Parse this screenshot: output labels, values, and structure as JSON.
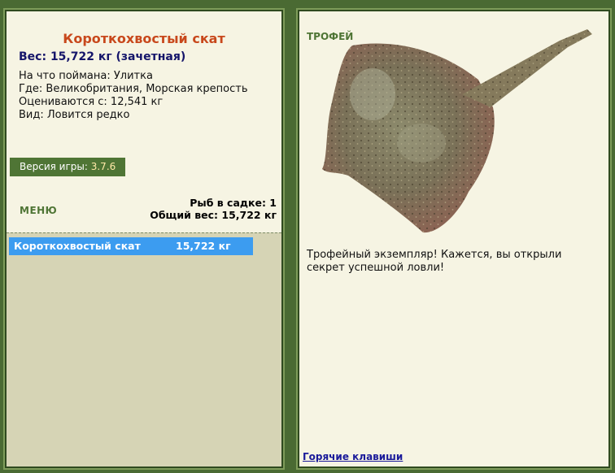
{
  "fish": {
    "name": "Короткохвостый скат",
    "weight_line": "Вес: 15,722 кг (зачетная)",
    "bait": "На что поймана: Улитка",
    "location": "Где: Великобритания, Морская крепость",
    "valued_from": "Оцениваются с: 12,541 кг",
    "rarity": "Вид: Ловится редко"
  },
  "version": {
    "label": "Версия игры:",
    "value": "3.7.6"
  },
  "menu_label": "МЕНЮ",
  "stats": {
    "fish_in_keepnet": "Рыб в садке: 1",
    "total_weight": "Общий вес: 15,722 кг"
  },
  "catch_list": [
    {
      "name": "Короткохвостый скат",
      "weight": "15,722 кг"
    }
  ],
  "trophy": {
    "label": "ТРОФЕЙ",
    "description": "Трофейный экземпляр! Кажется, вы открыли секрет успешной ловли!",
    "image_icon": "stingray-image"
  },
  "hotkeys_label": "Горячие клавиши",
  "colors": {
    "panel_bg": "#f6f4e3",
    "list_bg": "#d6d4b5",
    "frame": "#4a6a33",
    "title": "#c8481c",
    "weight": "#15156a",
    "selection": "#3c9cf0",
    "accent_green": "#4f7535"
  }
}
